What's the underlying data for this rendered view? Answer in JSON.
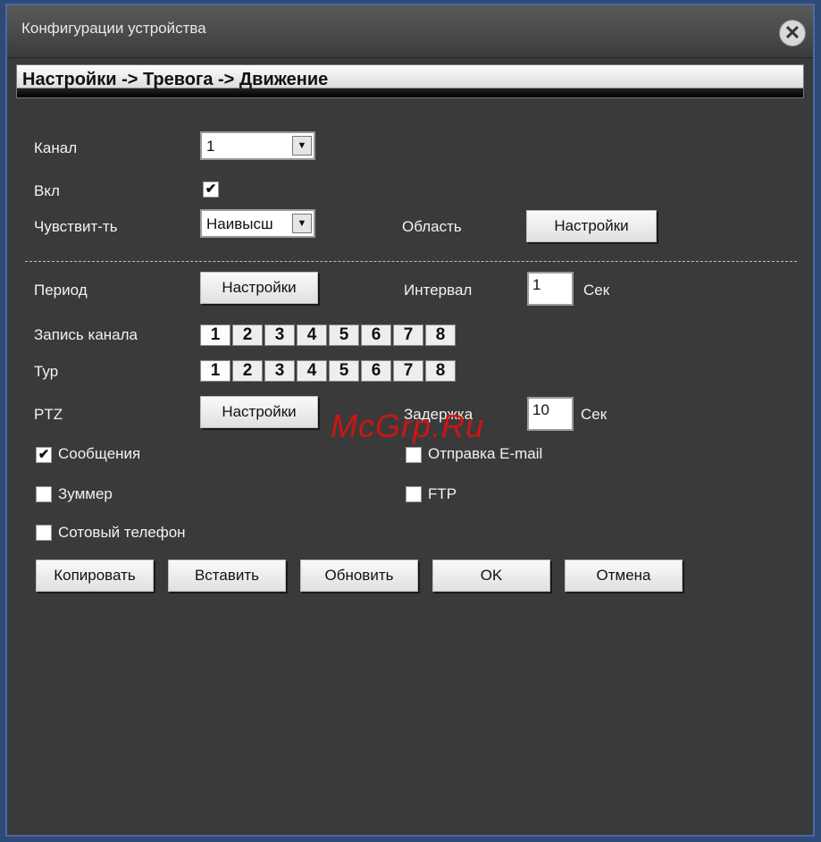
{
  "window": {
    "title": "Конфигурации устройства",
    "close_glyph": "✕"
  },
  "breadcrumb": "Настройки -> Тревога -> Движение",
  "form": {
    "channel_label": "Канал",
    "channel_value": "1",
    "enable_label": "Вкл",
    "enable_checked": "✔",
    "sensitivity_label": "Чувствит-ть",
    "sensitivity_value": "Наивысш",
    "region_label": "Область",
    "region_button": "Настройки",
    "period_label": "Период",
    "period_button": "Настройки",
    "interval_label": "Интервал",
    "interval_value": "1",
    "interval_unit": "Сек",
    "record_channel_label": "Запись канала",
    "record_channels": [
      "1",
      "2",
      "3",
      "4",
      "5",
      "6",
      "7",
      "8"
    ],
    "tour_label": "Тур",
    "tour_channels": [
      "1",
      "2",
      "3",
      "4",
      "5",
      "6",
      "7",
      "8"
    ],
    "ptz_label": "PTZ",
    "ptz_button": "Настройки",
    "delay_label": "Задержка",
    "delay_value": "10",
    "delay_unit": "Сек",
    "show_message_label": "Сообщения",
    "show_message_checked": "✔",
    "send_email_label": "Отправка E-mail",
    "buzzer_label": "Зуммер",
    "ftp_label": "FTP",
    "mobile_label": "Сотовый телефон"
  },
  "buttons": {
    "copy": "Копировать",
    "paste": "Вставить",
    "refresh": "Обновить",
    "ok": "OK",
    "cancel": "Отмена"
  },
  "watermark": "McGrp.Ru"
}
